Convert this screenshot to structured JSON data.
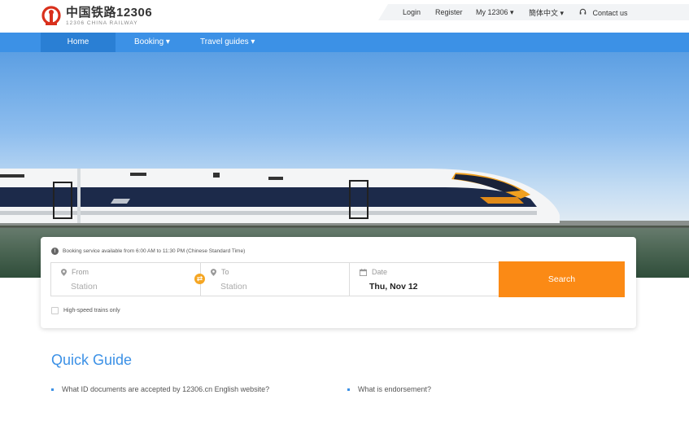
{
  "header": {
    "logo_cn": "中国铁路12306",
    "logo_en": "12306 CHINA RAILWAY",
    "links": {
      "login": "Login",
      "register": "Register",
      "my12306": "My 12306 ▾",
      "language": "簡体中文 ▾",
      "contact": "Contact us"
    }
  },
  "nav": {
    "home": "Home",
    "booking": "Booking ▾",
    "travel_guides": "Travel guides ▾"
  },
  "carousel": {
    "slide_count": 3,
    "active_index": 1
  },
  "booking": {
    "notice": "Booking service available from 6:00 AM to 11:30 PM (Chinese Standard Time)",
    "from_label": "From",
    "from_placeholder": "Station",
    "to_label": "To",
    "to_placeholder": "Station",
    "date_label": "Date",
    "date_value": "Thu, Nov 12",
    "search_label": "Search",
    "highspeed_label": "High-speed trains only"
  },
  "quick_guide": {
    "title": "Quick Guide",
    "items": [
      "What ID documents are accepted by 12306.cn English website?",
      "What is endorsement?"
    ]
  },
  "colors": {
    "nav_blue": "#3c91e6",
    "search_orange": "#fb8a15",
    "logo_red": "#d9301c"
  }
}
